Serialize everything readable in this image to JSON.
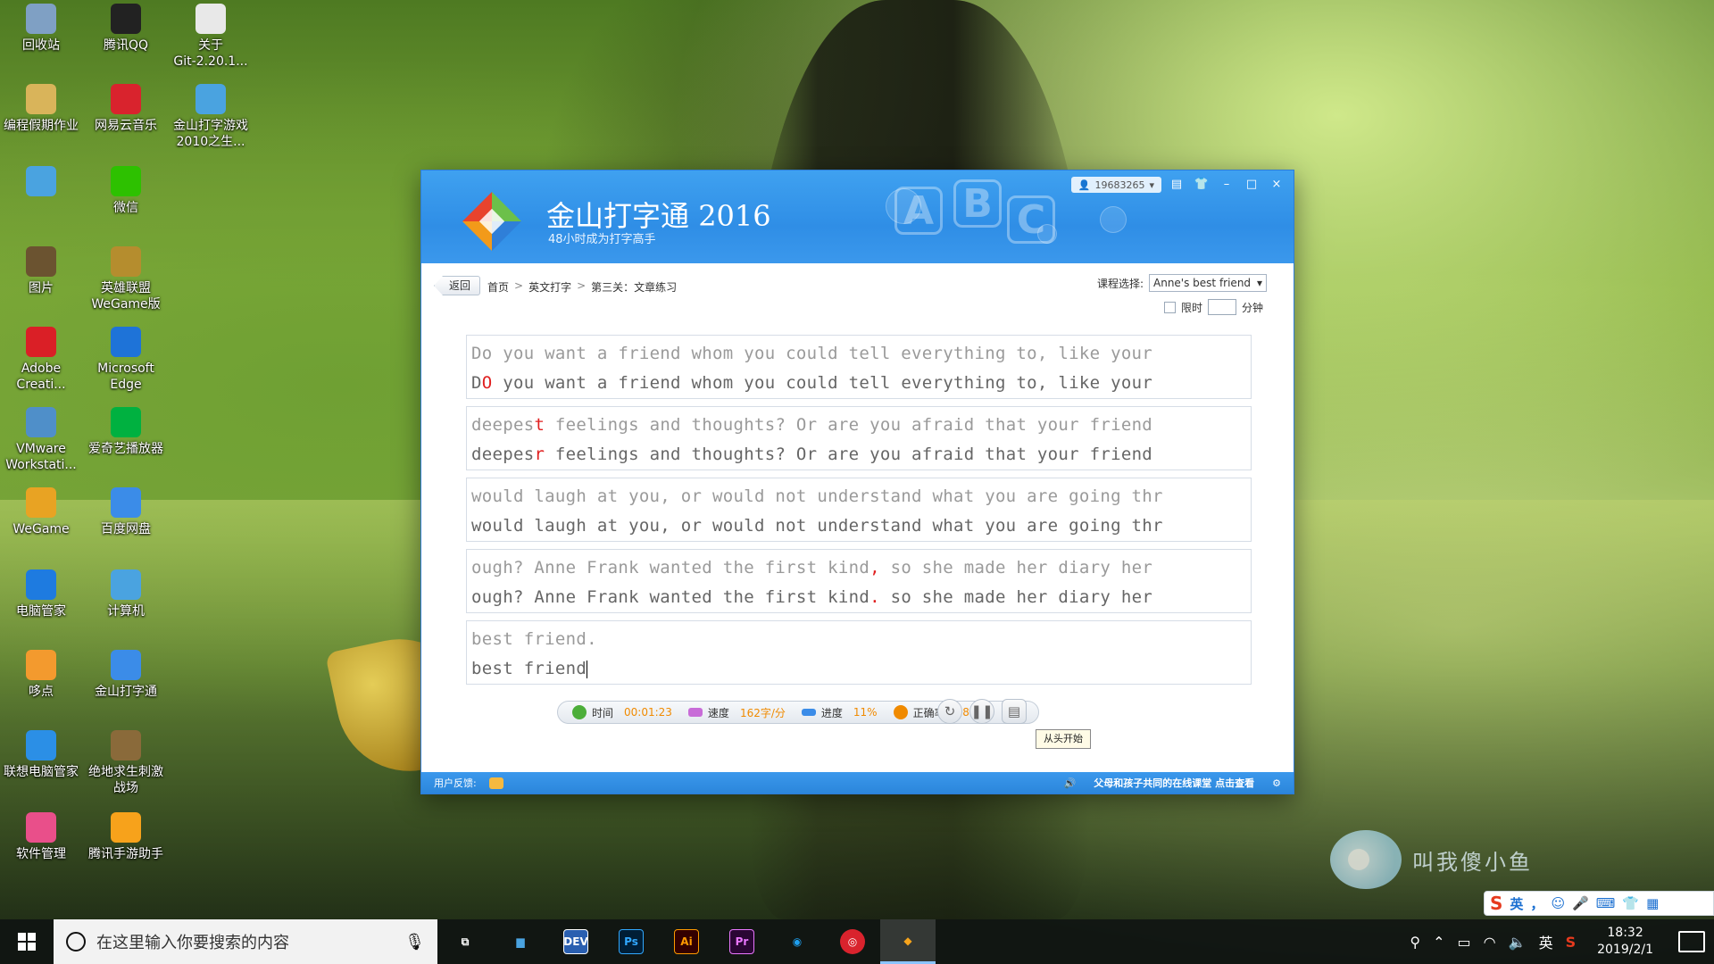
{
  "desktop_icons": [
    {
      "label": "回收站",
      "icon": "recycle-bin-icon",
      "color": "#7fa0c4"
    },
    {
      "label": "腾讯QQ",
      "icon": "qq-penguin-icon",
      "color": "#222222"
    },
    {
      "label": "关于\nGit-2.20.1...",
      "icon": "document-icon",
      "color": "#e8e8e8"
    },
    {
      "label": "编程假期作业",
      "icon": "folder-icon",
      "color": "#d9b45a"
    },
    {
      "label": "网易云音乐",
      "icon": "netease-music-icon",
      "color": "#d9232d"
    },
    {
      "label": "金山打字游戏\n2010之生...",
      "icon": "typing-game-icon",
      "color": "#4aa3e0"
    },
    {
      "label": "",
      "icon": "monitor-icon",
      "color": "#4aa3e0"
    },
    {
      "label": "微信",
      "icon": "wechat-icon",
      "color": "#2dc100"
    },
    {
      "label": "图片",
      "icon": "folder-icon",
      "color": "#6b5330"
    },
    {
      "label": "英雄联盟\nWeGame版",
      "icon": "lol-icon",
      "color": "#b58d2e"
    },
    {
      "label": "Adobe\nCreati...",
      "icon": "adobe-cc-icon",
      "color": "#da1f26"
    },
    {
      "label": "Microsoft\nEdge",
      "icon": "edge-icon",
      "color": "#1e73d8"
    },
    {
      "label": "VMware\nWorkstati...",
      "icon": "vmware-icon",
      "color": "#4f8fc9"
    },
    {
      "label": "爱奇艺播放器",
      "icon": "iqiyi-icon",
      "color": "#00b140"
    },
    {
      "label": "WeGame",
      "icon": "wegame-icon",
      "color": "#e8a323"
    },
    {
      "label": "百度网盘",
      "icon": "baidu-netdisk-icon",
      "color": "#3b8ce8"
    },
    {
      "label": "电脑管家",
      "icon": "pc-manager-icon",
      "color": "#1e7be0"
    },
    {
      "label": "计算机",
      "icon": "computer-icon",
      "color": "#4aa3e0"
    },
    {
      "label": "哆点",
      "icon": "duodian-icon",
      "color": "#f39a2e"
    },
    {
      "label": "金山打字通",
      "icon": "jinshan-typing-icon",
      "color": "#3b8ce8"
    },
    {
      "label": "联想电脑管家",
      "icon": "lenovo-manager-icon",
      "color": "#2b8fe6"
    },
    {
      "label": "绝地求生刺激\n战场",
      "icon": "pubg-icon",
      "color": "#8a6a3a"
    },
    {
      "label": "软件管理",
      "icon": "software-manager-icon",
      "color": "#e94f8a"
    },
    {
      "label": "腾讯手游助手",
      "icon": "tencent-game-assistant-icon",
      "color": "#f7a21b"
    }
  ],
  "window": {
    "app_title": "金山打字通",
    "app_year": "2016",
    "app_subtitle": "48小时成为打字高手",
    "user_id": "19683265",
    "controls": {
      "min": "–",
      "max": "□",
      "close": "×"
    },
    "back_label": "返回",
    "breadcrumbs": [
      "首页",
      "英文打字",
      "第三关：文章练习"
    ],
    "course_label": "课程选择:",
    "course_value": "Anne's best friend",
    "limit_label": "限时",
    "minutes_label": "分钟",
    "lines": [
      {
        "source": [
          {
            "t": "Do",
            "e": false
          },
          {
            "t": " you want a friend whom you could tell everything to, like your",
            "e": false
          }
        ],
        "typed": [
          {
            "t": "D",
            "e": false
          },
          {
            "t": "O",
            "e": true
          },
          {
            "t": " you want a friend whom you could tell everything to, like your",
            "e": false
          }
        ]
      },
      {
        "source": [
          {
            "t": "deepes",
            "e": false
          },
          {
            "t": "t",
            "e": true
          },
          {
            "t": " feelings and thoughts? Or are you afraid that your friend",
            "e": false
          }
        ],
        "typed": [
          {
            "t": "deepes",
            "e": false
          },
          {
            "t": "r",
            "e": true
          },
          {
            "t": " feelings and thoughts? Or are you afraid that your friend",
            "e": false
          }
        ]
      },
      {
        "source": [
          {
            "t": "would laugh at you, or would not understand what you are going thr",
            "e": false
          }
        ],
        "typed": [
          {
            "t": "would laugh at you, or would not understand what you are going thr",
            "e": false
          }
        ]
      },
      {
        "source": [
          {
            "t": "ough? Anne Frank wanted the first kind",
            "e": false
          },
          {
            "t": ",",
            "e": true
          },
          {
            "t": " so she made her diary her",
            "e": false
          }
        ],
        "typed": [
          {
            "t": "ough? Anne Frank wanted the first kind",
            "e": false
          },
          {
            "t": ".",
            "e": true
          },
          {
            "t": " so she made her diary her",
            "e": false
          }
        ]
      },
      {
        "source": [
          {
            "t": "best friend.",
            "e": false
          }
        ],
        "typed": [
          {
            "t": "best friend",
            "e": false
          }
        ]
      }
    ],
    "stats": {
      "time_label": "时间",
      "time_value": "00:01:23",
      "speed_label": "速度",
      "speed_value": "162字/分",
      "progress_label": "进度",
      "progress_value": "11%",
      "accuracy_label": "正确率",
      "accuracy_value": "98%"
    },
    "tooltip": "从头开始",
    "feedback_label": "用户反馈:",
    "promo_text": "父母和孩子共同的在线课堂 点击查看"
  },
  "ime": {
    "lang": "英",
    "items": [
      "，",
      "☺",
      "🎤",
      "⌨",
      "👕",
      "▦"
    ]
  },
  "watermark": "叫我傻小鱼",
  "taskbar": {
    "search_placeholder": "在这里输入你要搜索的内容",
    "apps": [
      {
        "name": "task-view",
        "label": "⧉",
        "color": "#ffffff",
        "bg": "transparent"
      },
      {
        "name": "computer",
        "label": "▆",
        "color": "#4aa3e0",
        "bg": "transparent"
      },
      {
        "name": "devecostudio",
        "label": "DEV",
        "color": "#ffffff",
        "bg": "#2a5fb0"
      },
      {
        "name": "photoshop",
        "label": "Ps",
        "color": "#31a8ff",
        "bg": "#001e36"
      },
      {
        "name": "illustrator",
        "label": "Ai",
        "color": "#ff9a00",
        "bg": "#330000"
      },
      {
        "name": "premiere",
        "label": "Pr",
        "color": "#ea77ff",
        "bg": "#2a0634"
      },
      {
        "name": "qq-browser",
        "label": "◉",
        "color": "#1ea0f0",
        "bg": "transparent"
      },
      {
        "name": "netease-music",
        "label": "◎",
        "color": "#ffffff",
        "bg": "#d9232d"
      },
      {
        "name": "jinshan-typing",
        "label": "◆",
        "color": "#f6a41c",
        "bg": "transparent"
      }
    ],
    "tray_lang": "英",
    "time": "18:32",
    "date": "2019/2/1"
  }
}
